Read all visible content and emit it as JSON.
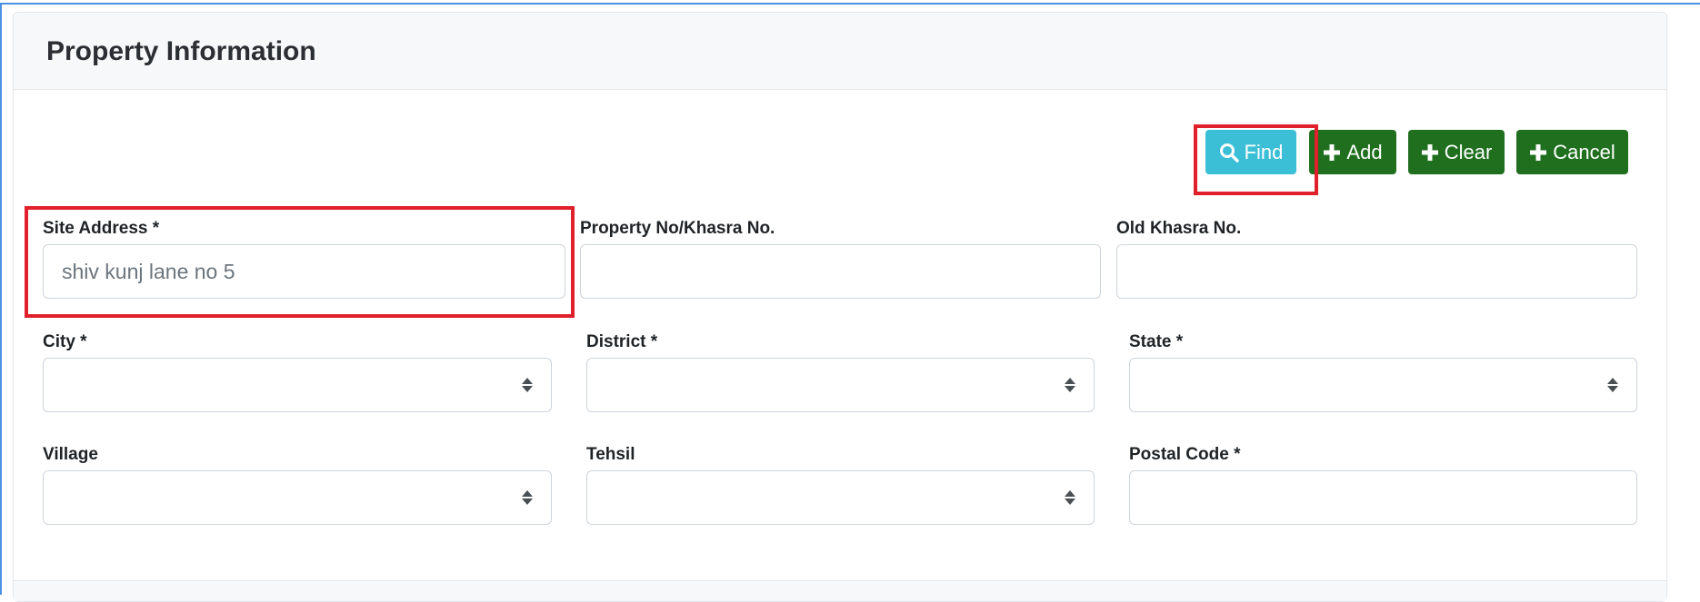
{
  "card": {
    "title": "Property Information"
  },
  "toolbar": {
    "find_label": "Find",
    "add_label": "Add",
    "clear_label": "Clear",
    "cancel_label": "Cancel"
  },
  "icons": {
    "find": "search-icon",
    "add": "plus-icon",
    "clear": "plus-icon",
    "cancel": "plus-icon"
  },
  "fields": {
    "site_address": {
      "label": "Site Address *",
      "value": "shiv kunj lane no 5"
    },
    "property_no": {
      "label": "Property No/Khasra No.",
      "value": ""
    },
    "old_khasra": {
      "label": "Old Khasra No.",
      "value": ""
    },
    "city": {
      "label": "City *",
      "value": ""
    },
    "district": {
      "label": "District *",
      "value": ""
    },
    "state": {
      "label": "State *",
      "value": ""
    },
    "village": {
      "label": "Village",
      "value": ""
    },
    "tehsil": {
      "label": "Tehsil",
      "value": ""
    },
    "postal_code": {
      "label": "Postal Code *",
      "value": ""
    }
  },
  "colors": {
    "find_button": "#3bbfd6",
    "action_button": "#1f6f1f",
    "highlight": "#e0202a"
  }
}
